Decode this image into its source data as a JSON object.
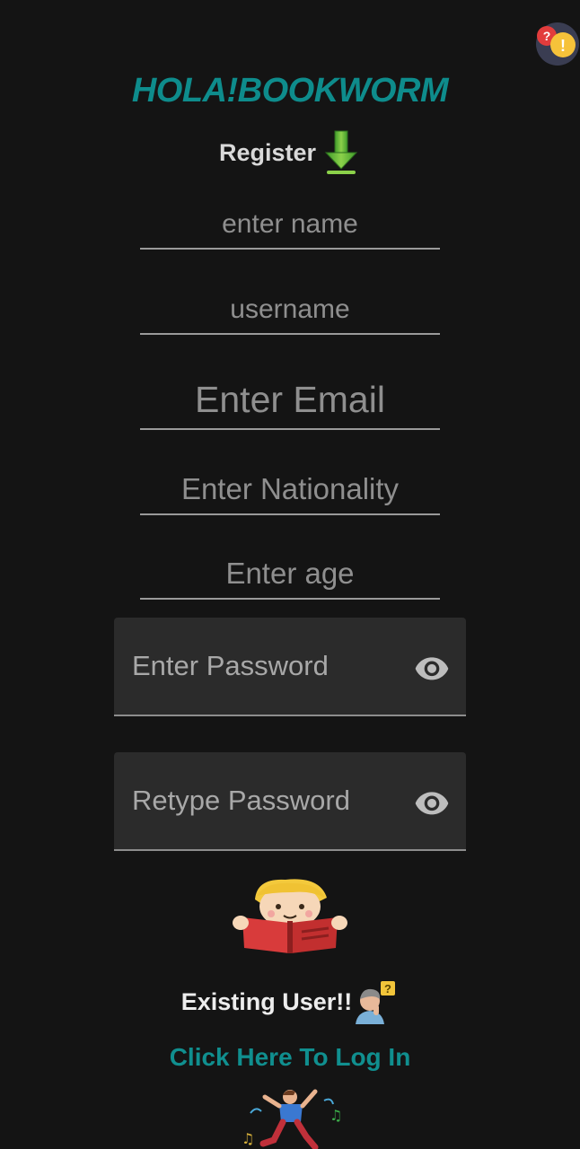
{
  "app": {
    "title": "HOLA!BOOKWORM"
  },
  "register": {
    "label": "Register",
    "icon": "down-arrow-icon"
  },
  "fields": {
    "name": {
      "placeholder": "enter name"
    },
    "username": {
      "placeholder": "username"
    },
    "email": {
      "placeholder": "Enter Email"
    },
    "nationality": {
      "placeholder": "Enter Nationality"
    },
    "age": {
      "placeholder": "Enter age"
    },
    "password": {
      "placeholder": "Enter Password",
      "icon": "eye-icon"
    },
    "retype_password": {
      "placeholder": "Retype Password",
      "icon": "eye-icon"
    }
  },
  "existing_user": {
    "label": "Existing User!!",
    "icon": "confused-person-icon"
  },
  "login": {
    "link_label": "Click Here To Log In"
  },
  "colors": {
    "accent": "#0e8c8c",
    "background": "#141414",
    "field_bg": "#2b2b2b"
  }
}
